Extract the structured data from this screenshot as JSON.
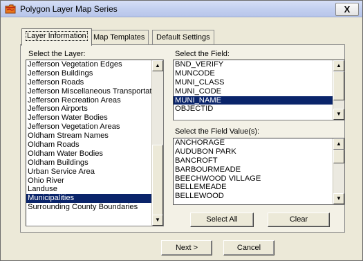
{
  "window": {
    "title": "Polygon Layer Map Series",
    "close_glyph": "X"
  },
  "tabs": [
    {
      "label": "Layer Information",
      "active": true
    },
    {
      "label": "Map Templates",
      "active": false
    },
    {
      "label": "Default Settings",
      "active": false
    }
  ],
  "layer": {
    "label": "Select the Layer:",
    "items": [
      "Jefferson Vegetation Edges",
      "Jefferson Buildings",
      "Jefferson Roads",
      "Jefferson Miscellaneous Transportati",
      "Jefferson Recreation Areas",
      "Jefferson Airports",
      "Jefferson Water Bodies",
      "Jefferson Vegetation Areas",
      "Oldham Stream Names",
      "Oldham Roads",
      "Oldham Water Bodies",
      "Oldham Buildings",
      "Urban Service Area",
      "Ohio River",
      "Landuse",
      "Municipalities",
      "Surrounding County Boundaries"
    ],
    "selected": "Municipalities"
  },
  "field": {
    "label": "Select the Field:",
    "items": [
      "BND_VERIFY",
      "MUNCODE",
      "MUNI_CLASS",
      "MUNI_CODE",
      "MUNI_NAME",
      "OBJECTID"
    ],
    "selected": "MUNI_NAME"
  },
  "field_value": {
    "label": "Select the Field Value(s):",
    "items": [
      "ANCHORAGE",
      "AUDUBON PARK",
      "BANCROFT",
      "BARBOURMEADE",
      "BEECHWOOD VILLAGE",
      "BELLEMEADE",
      "BELLEWOOD"
    ]
  },
  "buttons": {
    "select_all": "Select All",
    "clear": "Clear",
    "next": "Next >",
    "cancel": "Cancel"
  },
  "icons": {
    "app": "folder-map-icon",
    "scroll_up": "scroll-up-arrow-icon",
    "scroll_down": "scroll-down-arrow-icon"
  },
  "colors": {
    "selection": "#0a246a",
    "selection_text": "#ffffff",
    "dialog_bg": "#ece9d8",
    "title_bar": "#c2cfef"
  }
}
